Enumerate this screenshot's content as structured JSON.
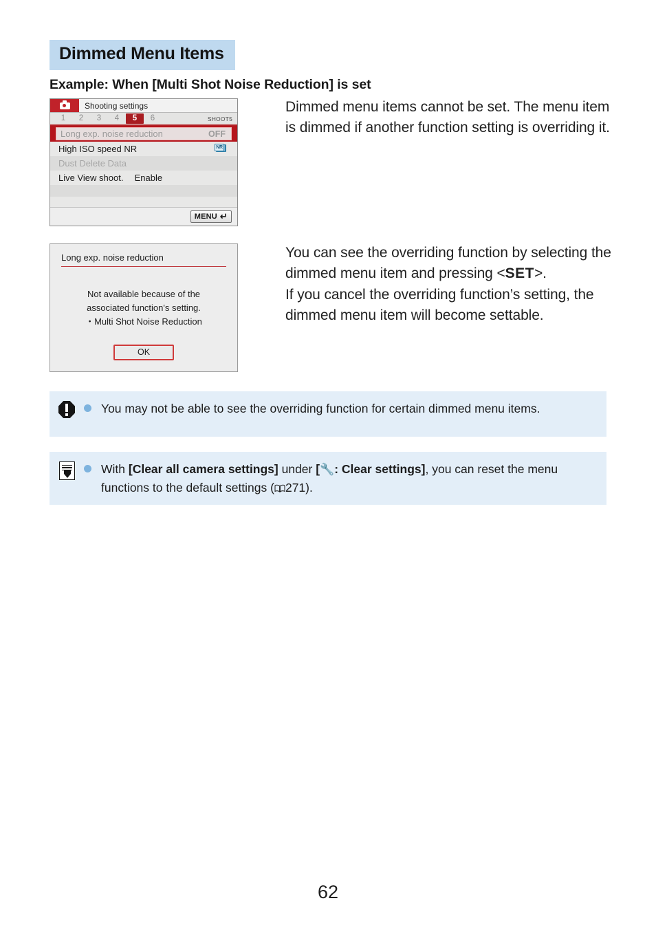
{
  "page": {
    "heading": "Dimmed Menu Items",
    "sub_heading": "Example: When [Multi Shot Noise Reduction] is set",
    "page_number": "62",
    "heading_highlight_color": "#bfd9ef",
    "note_box_color": "#e3eef8",
    "accent_red": "#b5151c"
  },
  "camera_screen": {
    "title": "Shooting settings",
    "camera_icon": "camera-icon",
    "tabs": [
      "1",
      "2",
      "3",
      "4",
      "5",
      "6"
    ],
    "active_tab": "5",
    "tab_group_label": "SHOOT5",
    "rows": [
      {
        "label": "Long exp. noise reduction",
        "value": "OFF",
        "state": "selected-dimmed"
      },
      {
        "label": "High ISO speed NR",
        "value": "",
        "value_icon": "NR",
        "state": "normal"
      },
      {
        "label": "Dust Delete Data",
        "value": "",
        "state": "dimmed"
      },
      {
        "label": "Live View shoot.",
        "value": "Enable",
        "state": "normal"
      }
    ],
    "footer_button": {
      "label": "MENU",
      "icon": "return-arrow-icon"
    }
  },
  "dialog": {
    "title": "Long exp. noise reduction",
    "message_line1": "Not available because of the",
    "message_line2": "associated function's setting.",
    "message_line3": "・Multi Shot Noise Reduction",
    "ok_label": "OK"
  },
  "body": {
    "paragraph_1": "Dimmed menu items cannot be set. The menu item is dimmed if another function setting is overriding it.",
    "paragraph_2_part1": "You can see the overriding function by selecting the dimmed menu item and pressing <",
    "paragraph_2_set": "SET",
    "paragraph_2_part2": ">.",
    "paragraph_2_part3": "If you cancel the overriding function’s setting, the dimmed menu item will become settable."
  },
  "notes": [
    {
      "icon": "caution-icon",
      "bullet": "bullet-icon",
      "text": "You may not be able to see the overriding function for certain dimmed menu items."
    },
    {
      "icon": "note-pencil-icon",
      "bullet": "bullet-icon",
      "segments": {
        "s1": "With ",
        "s2": "[Clear all camera settings]",
        "s3": " under ",
        "s4_open": "[",
        "s4_icon": "wrench-icon",
        "s4_rest": ": Clear settings]",
        "s5": ", you can reset the menu functions to the default settings (",
        "s6_icon": "book-icon",
        "s6_page": "271",
        "s7": ")."
      }
    }
  ]
}
